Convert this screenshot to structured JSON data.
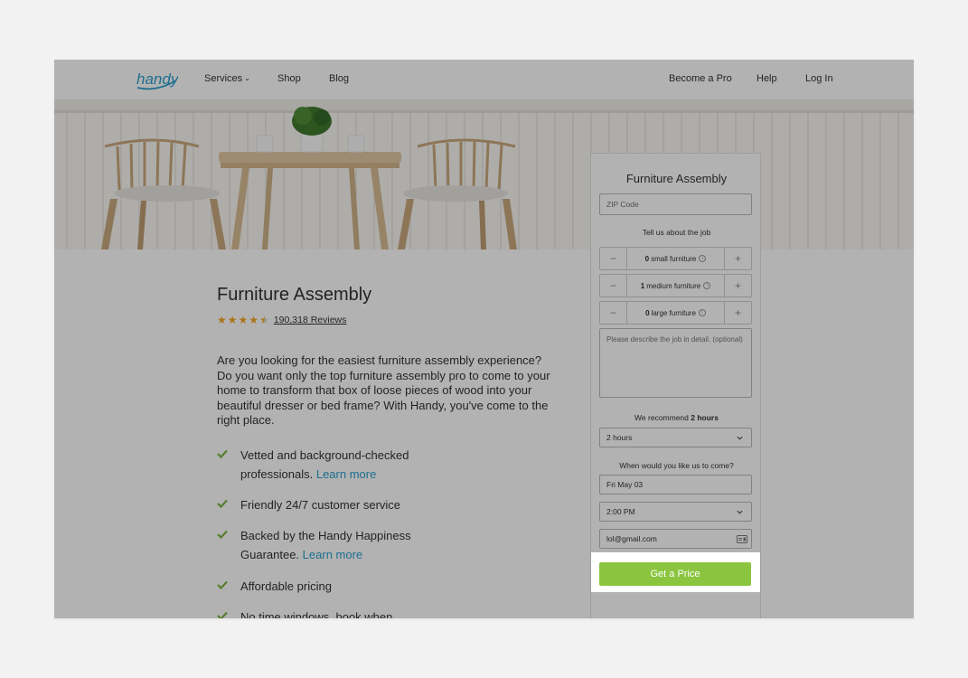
{
  "header": {
    "logo_text": "handy",
    "nav_left": [
      {
        "label": "Services",
        "has_dropdown": true
      },
      {
        "label": "Shop"
      },
      {
        "label": "Blog"
      }
    ],
    "nav_right": [
      {
        "label": "Become a Pro"
      },
      {
        "label": "Help"
      },
      {
        "label": "Log In"
      }
    ]
  },
  "main": {
    "title": "Furniture Assembly",
    "rating": {
      "stars": 4.5,
      "max": 5,
      "reviews_label": "190,318 Reviews"
    },
    "intro": "Are you looking for the easiest furniture assembly experience? Do you want only the top furniture assembly pro to come to your home to transform that box of loose pieces of wood into your beautiful dresser or bed frame? With Handy, you've come to the right place.",
    "features": [
      {
        "text": "Vetted and background-checked professionals.",
        "link": "Learn more"
      },
      {
        "text": "Friendly 24/7 customer service",
        "link": ""
      },
      {
        "text": "Backed by the Handy Happiness Guarantee.",
        "link": "Learn more"
      },
      {
        "text": "Affordable pricing",
        "link": ""
      },
      {
        "text": "No time windows, book when",
        "link": ""
      }
    ]
  },
  "booking": {
    "title": "Furniture Assembly",
    "zip_placeholder": "ZIP Code",
    "job_label": "Tell us about the job",
    "steppers": [
      {
        "count": "0",
        "label": "small furniture"
      },
      {
        "count": "1",
        "label": "medium furniture"
      },
      {
        "count": "0",
        "label": "large furniture"
      }
    ],
    "stepper_minus": "−",
    "stepper_plus": "+",
    "info_glyph": "i",
    "details_placeholder": "Please describe the job in detail. (optional)",
    "recommend_prefix": "We recommend ",
    "recommend_value": "2 hours",
    "hours_value": "2 hours",
    "when_label": "When would you like us to come?",
    "date_value": "Fri May 03",
    "time_value": "2:00 PM",
    "email_value": "lol@gmail.com",
    "cta_label": "Get a Price"
  },
  "colors": {
    "brand": "#2aa0cf",
    "cta": "#8bc53f",
    "stars": "#f5a623",
    "check": "#7cb342",
    "overlay": "rgba(0,0,0,0.30)"
  },
  "icons": [
    "chevron-down-icon",
    "star-icon",
    "check-icon",
    "info-icon",
    "credit-card-icon"
  ]
}
